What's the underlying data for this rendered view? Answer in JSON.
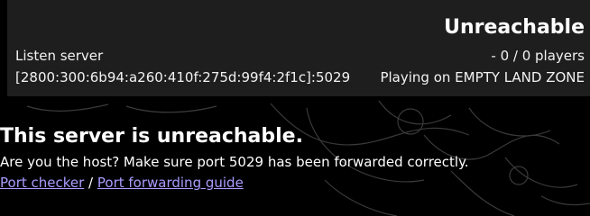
{
  "server": {
    "status": "Unreachable",
    "type": "Listen server",
    "address": "[2800:300:6b94:a260:410f:275d:99f4:2f1c]:5029",
    "players": "- 0 / 0 players",
    "map": "Playing on EMPTY LAND ZONE"
  },
  "message": {
    "title": "This server is unreachable.",
    "body": "Are you the host? Make sure port 5029 has been forwarded correctly."
  },
  "links": {
    "port_checker": "Port checker",
    "separator": " / ",
    "port_forwarding_guide": "Port forwarding guide"
  },
  "colors": {
    "background": "#000000",
    "card": "#1e1e1e",
    "text": "#ffffff",
    "link": "#a99cff"
  }
}
